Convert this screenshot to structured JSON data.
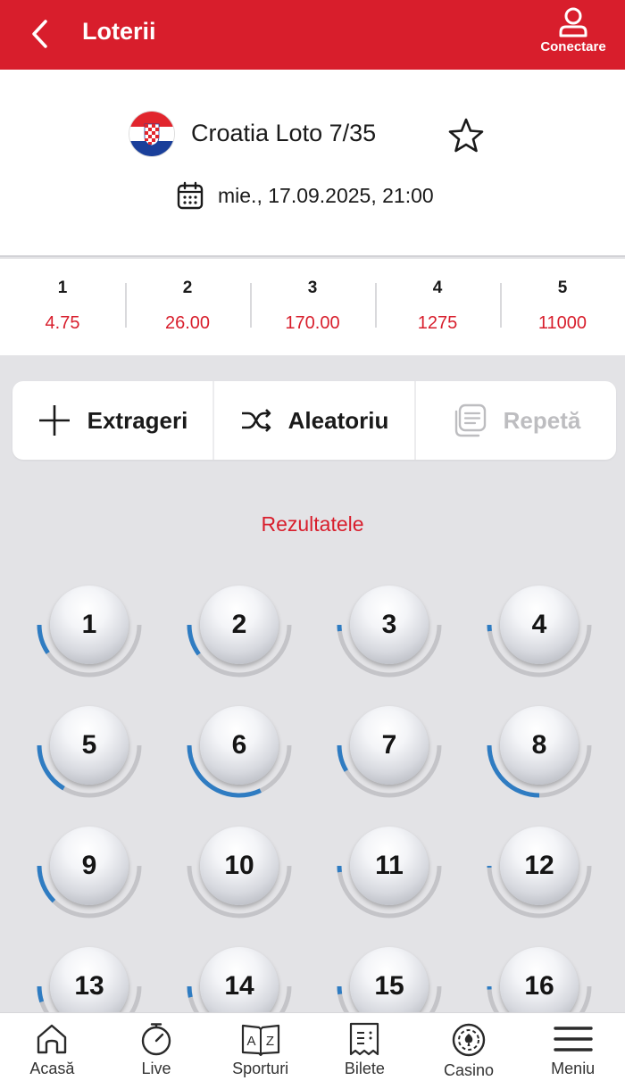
{
  "header": {
    "title": "Loterii",
    "login_label": "Conectare"
  },
  "event": {
    "name": "Croatia Loto 7/35",
    "datetime": "mie., 17.09.2025, 21:00",
    "flag": "croatia-flag"
  },
  "odds": [
    {
      "hits": "1",
      "value": "4.75"
    },
    {
      "hits": "2",
      "value": "26.00"
    },
    {
      "hits": "3",
      "value": "170.00"
    },
    {
      "hits": "4",
      "value": "1275"
    },
    {
      "hits": "5",
      "value": "11000"
    }
  ],
  "actions": {
    "draws": "Extrageri",
    "random": "Aleatoriu",
    "repeat": "Repetă"
  },
  "results_title": "Rezultatele",
  "balls": [
    {
      "n": "1",
      "f": 0.19
    },
    {
      "n": "2",
      "f": 0.2
    },
    {
      "n": "3",
      "f": 0.04
    },
    {
      "n": "4",
      "f": 0.04
    },
    {
      "n": "5",
      "f": 0.33
    },
    {
      "n": "6",
      "f": 0.64
    },
    {
      "n": "7",
      "f": 0.17
    },
    {
      "n": "8",
      "f": 0.5
    },
    {
      "n": "9",
      "f": 0.25
    },
    {
      "n": "10",
      "f": 0.0
    },
    {
      "n": "11",
      "f": 0.04
    },
    {
      "n": "12",
      "f": 0.01
    },
    {
      "n": "13",
      "f": 0.1
    },
    {
      "n": "14",
      "f": 0.07
    },
    {
      "n": "15",
      "f": 0.05
    },
    {
      "n": "16",
      "f": 0.02
    }
  ],
  "nav": [
    {
      "label": "Acasă",
      "icon": "home-icon"
    },
    {
      "label": "Live",
      "icon": "stopwatch-icon"
    },
    {
      "label": "Sporturi",
      "icon": "book-az-icon"
    },
    {
      "label": "Bilete",
      "icon": "ticket-icon"
    },
    {
      "label": "Casino",
      "icon": "casino-chip-icon"
    },
    {
      "label": "Meniu",
      "icon": "menu-icon"
    }
  ],
  "colors": {
    "brand": "#d81e2c",
    "ring_fill": "#2f7cc2",
    "ring_track": "#c4c4c8",
    "background": "#e3e3e6"
  }
}
